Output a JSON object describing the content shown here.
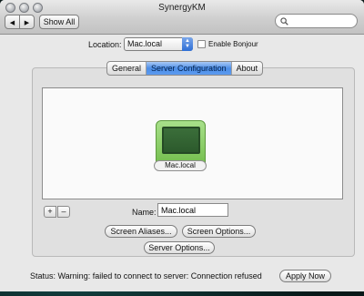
{
  "window": {
    "title": "SynergyKM",
    "back_label": "◀",
    "forward_label": "▶",
    "show_all_label": "Show All",
    "search_placeholder": ""
  },
  "location": {
    "label": "Location:",
    "selected": "Mac.local",
    "bonjour_label": "Enable Bonjour",
    "bonjour_checked": false
  },
  "tabs": [
    {
      "label": "General",
      "active": false
    },
    {
      "label": "Server Configuration",
      "active": true
    },
    {
      "label": "About",
      "active": false
    }
  ],
  "layout": {
    "screen_name": "Mac.local",
    "add_label": "+",
    "remove_label": "–",
    "name_label": "Name:",
    "name_value": "Mac.local",
    "screen_aliases_label": "Screen Aliases...",
    "screen_options_label": "Screen Options...",
    "server_options_label": "Server Options..."
  },
  "status": {
    "text": "Status:  Warning: failed to connect to server: Connection refused",
    "apply_label": "Apply Now"
  },
  "colors": {
    "accent": "#4d8ee6",
    "monitor_green": "#6fbb48"
  }
}
